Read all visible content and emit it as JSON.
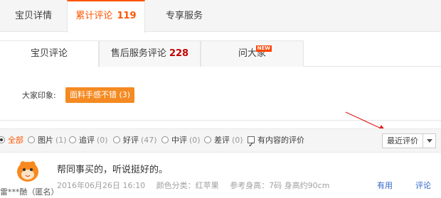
{
  "top_tabs": {
    "detail": "宝贝详情",
    "reviews": "累计评论",
    "reviews_count": "119",
    "service": "专享服务"
  },
  "sub_tabs": {
    "item_reviews": "宝贝评论",
    "after_sale": "售后服务评论",
    "after_sale_count": "228",
    "ask": "问大家",
    "new_badge": "NEW"
  },
  "impression": {
    "label": "大家印象:",
    "tag": "面料手感不错 (3)"
  },
  "filters": {
    "all": "全部",
    "pictures": "图片",
    "pictures_count": "(1)",
    "followup": "追评",
    "followup_count": "(0)",
    "good": "好评",
    "good_count": "(47)",
    "neutral": "中评",
    "neutral_count": "(0)",
    "bad": "差评",
    "bad_count": "(0)",
    "with_content": "有内容的评价",
    "sort_label": "最近评价"
  },
  "review": {
    "text": "帮同事买的，听说挺好的。",
    "date": "2016年06月26日 16:10",
    "color": "颜色分类：红苹果",
    "height": "参考身高：7码 身高约90cm",
    "user": "雷***酏（匿名）",
    "useful": "有用",
    "reply": "评论"
  },
  "colors": {
    "accent": "#ff5500",
    "tag_bg": "#f48a21",
    "annotation": "#e02020"
  }
}
